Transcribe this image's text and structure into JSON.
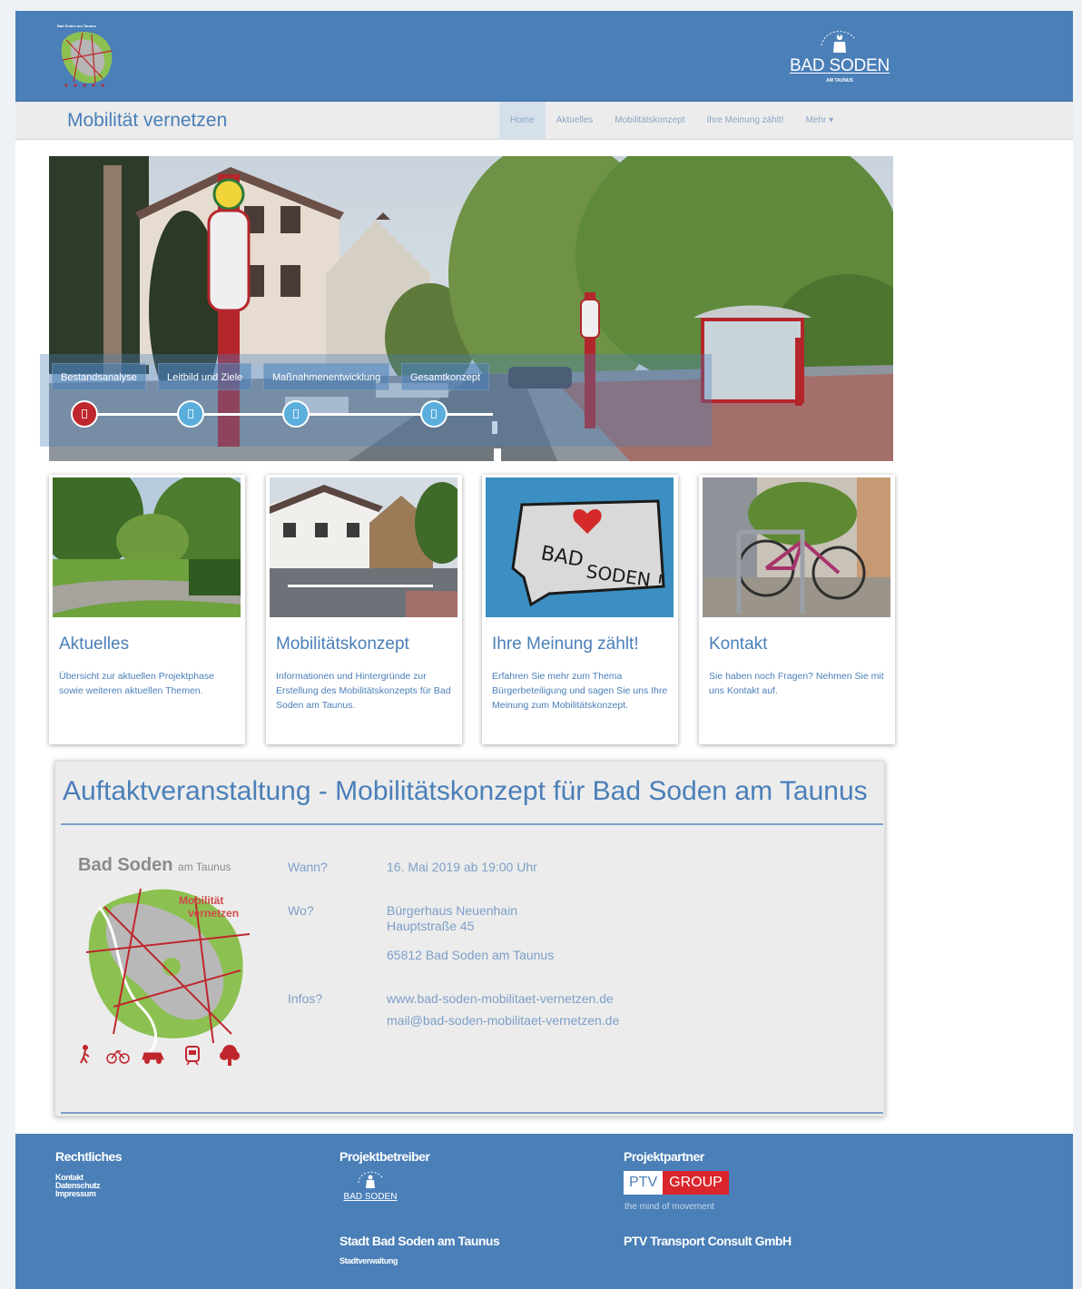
{
  "header": {
    "logo_left_text": "Bad Soden am Taunus",
    "logo_right_name": "BAD SODEN",
    "logo_right_sub": "AM TAUNUS"
  },
  "navbar": {
    "brand": "Mobilität vernetzen",
    "items": [
      {
        "label": "Home",
        "active": true
      },
      {
        "label": "Aktuelles",
        "active": false
      },
      {
        "label": "Mobilitätskonzept",
        "active": false
      },
      {
        "label": "Ihre Meinung zählt!",
        "active": false
      },
      {
        "label": "Mehr ▾",
        "active": false
      }
    ]
  },
  "hero": {
    "steps": [
      {
        "label": "Bestandsanalyse",
        "state": "current"
      },
      {
        "label": "Leitbild und Ziele",
        "state": "upcoming"
      },
      {
        "label": "Maßnahmenentwicklung",
        "state": "upcoming"
      },
      {
        "label": "Gesamtkonzept",
        "state": "upcoming"
      }
    ]
  },
  "cards": [
    {
      "title": "Aktuelles",
      "desc": "Übersicht zur aktuellen Projektphase sowie weiteren aktuellen Themen."
    },
    {
      "title": "Mobilitätskonzept",
      "desc": "Informationen und Hintergründe zur Erstellung des Mobilitätskonzepts für Bad Soden am Taunus."
    },
    {
      "title": "Ihre Meinung zählt!",
      "desc": "Erfahren Sie mehr zum Thema Bürgerbeteiligung und sagen Sie uns Ihre Meinung zum Mobilitätskonzept."
    },
    {
      "title": "Kontakt",
      "desc": "Sie haben noch Fragen? Nehmen Sie mit uns Kontakt auf."
    }
  ],
  "card_images": {
    "graffiti_line1": "BAD",
    "graffiti_line2": "SODEN !"
  },
  "event": {
    "title": "Auftaktveranstaltung - Mobilitätskonzept für Bad Soden am Taunus",
    "flyer": {
      "name": "Bad Soden",
      "name_suffix": "am Taunus",
      "mob_line1": "Mobilität",
      "mob_line2": "vernetzen"
    },
    "when_label": "Wann?",
    "when_value": "16. Mai 2019 ab 19:00 Uhr",
    "where_label": "Wo?",
    "where_line1": "Bürgerhaus Neuenhain",
    "where_line2": "Hauptstraße 45",
    "where_line3": "65812 Bad Soden am Taunus",
    "info_label": "Infos?",
    "info_web": "www.bad-soden-mobilitaet-vernetzen.de",
    "info_mail": "mail@bad-soden-mobilitaet-vernetzen.de"
  },
  "footer": {
    "legal_head": "Rechtliches",
    "legal_links": [
      "Kontakt",
      "Datenschutz",
      "Impressum"
    ],
    "operator_head": "Projektbetreiber",
    "operator_logo": "BAD SODEN",
    "operator_name": "Stadt Bad Soden am Taunus",
    "operator_sub": "Stadtverwaltung",
    "partner_head": "Projektpartner",
    "partner_logo_a": "PTV",
    "partner_logo_b": "GROUP",
    "partner_tagline": "the mind of movement",
    "partner_name": "PTV Transport Consult GmbH"
  },
  "colors": {
    "primary": "#4a7fb8",
    "step_current": "#c0262d",
    "step_upcoming": "#5aaedb",
    "ptv_red": "#d9252b"
  }
}
